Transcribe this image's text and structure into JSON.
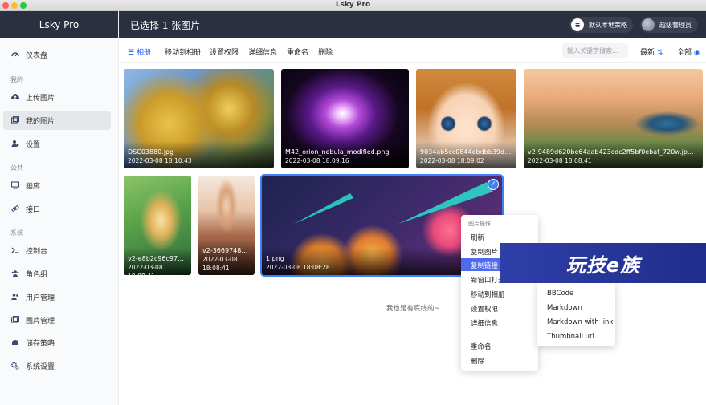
{
  "window": {
    "title": "Lsky Pro"
  },
  "sidebar": {
    "brand": "Lsky Pro",
    "items": [
      {
        "label": "仪表盘",
        "icon": "speedometer-icon"
      },
      {
        "label": "我的",
        "section": true
      },
      {
        "label": "上传图片",
        "icon": "cloud-upload-icon"
      },
      {
        "label": "我的图片",
        "icon": "images-icon",
        "active": true
      },
      {
        "label": "设置",
        "icon": "user-cog-icon"
      },
      {
        "label": "公共",
        "section": true
      },
      {
        "label": "画廊",
        "icon": "monitor-icon"
      },
      {
        "label": "接口",
        "icon": "link-icon"
      },
      {
        "label": "系统",
        "section": true
      },
      {
        "label": "控制台",
        "icon": "terminal-icon"
      },
      {
        "label": "角色组",
        "icon": "users-icon"
      },
      {
        "label": "用户管理",
        "icon": "user-manage-icon"
      },
      {
        "label": "图片管理",
        "icon": "image-manage-icon"
      },
      {
        "label": "储存策略",
        "icon": "storage-icon"
      },
      {
        "label": "系统设置",
        "icon": "cogs-icon"
      }
    ]
  },
  "header": {
    "title": "已选择 1 张图片",
    "strategy": "默认本地策略",
    "user": "超级管理员"
  },
  "toolbar": {
    "album": "相册",
    "move": "移动到相册",
    "permission": "设置权限",
    "details": "详细信息",
    "rename": "重命名",
    "delete": "删除",
    "search_placeholder": "输入关键字搜索...",
    "sort": "最新",
    "filter": "全部"
  },
  "images": [
    {
      "name": "DSC03880.jpg",
      "date": "2022-03-08 18:10:43"
    },
    {
      "name": "M42_orion_nebula_modified.png",
      "date": "2022-03-08 18:09:16"
    },
    {
      "name": "9034ab5cc0844ebdbb39dc...",
      "date": "2022-03-08 18:09:02"
    },
    {
      "name": "v2-9489d620be64aab423cdc2ff5bf0ebaf_720w.jp...",
      "date": "2022-03-08 18:08:41"
    },
    {
      "name": "v2-e8b2c96c975f...",
      "date": "2022-03-08 18:08:41"
    },
    {
      "name": "v2-36697487...",
      "date_line1": "2022-03-08",
      "date_line2": "18:08:41"
    },
    {
      "name": "1.png",
      "date": "2022-03-08 18:08:28",
      "selected": true
    }
  ],
  "footer_text": "我也是有底线的~",
  "context_menu": {
    "header": "图片操作",
    "items": [
      "刷新",
      "复制图片",
      "复制链接",
      "新窗口打开",
      "移动到相册",
      "设置权限",
      "详细信息",
      "重命名",
      "删除"
    ],
    "highlighted": "复制链接",
    "submenu": [
      "BBCode",
      "Markdown",
      "Markdown with link",
      "Thumbnail url"
    ]
  },
  "watermark": "玩技e族",
  "colors": {
    "dark": "#2b3040",
    "accent": "#3b82f6",
    "menu_highlight": "#4f6bed"
  }
}
